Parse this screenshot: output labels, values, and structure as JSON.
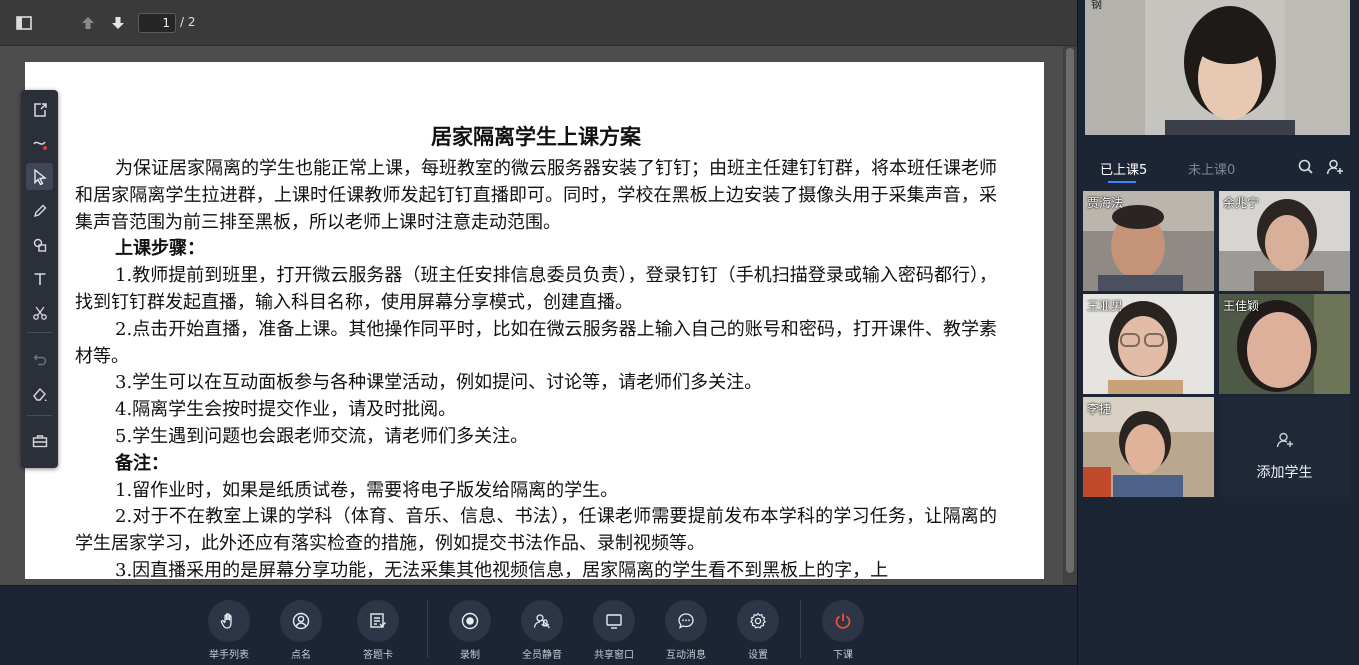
{
  "viewer": {
    "current_page": "1",
    "total_pages": "/ 2"
  },
  "document": {
    "title": "居家隔离学生上课方案",
    "paragraphs": [
      {
        "text": "为保证居家隔离的学生也能正常上课，每班教室的微云服务器安装了钉钉；由班主任建钉钉群，将本班任课老师和居家隔离学生拉进群，上课时任课教师发起钉钉直播即可。同时，学校在黑板上边安装了摄像头用于采集声音，采集声音范围为前三排至黑板，所以老师上课时注意走动范围。",
        "bold": false
      },
      {
        "text": "上课步骤：",
        "bold": true
      },
      {
        "text": "1.教师提前到班里，打开微云服务器（班主任安排信息委员负责），登录钉钉（手机扫描登录或输入密码都行），找到钉钉群发起直播，输入科目名称，使用屏幕分享模式，创建直播。",
        "bold": false
      },
      {
        "text": "2.点击开始直播，准备上课。其他操作同平时，比如在微云服务器上输入自己的账号和密码，打开课件、教学素材等。",
        "bold": false
      },
      {
        "text": "3.学生可以在互动面板参与各种课堂活动，例如提问、讨论等，请老师们多关注。",
        "bold": false
      },
      {
        "text": "4.隔离学生会按时提交作业，请及时批阅。",
        "bold": false
      },
      {
        "text": "5.学生遇到问题也会跟老师交流，请老师们多关注。",
        "bold": false
      },
      {
        "text": "备注：",
        "bold": true
      },
      {
        "text": "1.留作业时，如果是纸质试卷，需要将电子版发给隔离的学生。",
        "bold": false
      },
      {
        "text": "2.对于不在教室上课的学科（体育、音乐、信息、书法），任课老师需要提前发布本学科的学习任务，让隔离的学生居家学习，此外还应有落实检查的措施，例如提交书法作品、录制视频等。",
        "bold": false
      },
      {
        "text": "3.因直播采用的是屏幕分享功能，无法采集其他视频信息，居家隔离的学生看不到黑板上的字，上",
        "bold": false
      }
    ]
  },
  "right_panel": {
    "teacher_label": "钢",
    "tab_attending": "已上课5",
    "tab_absent": "未上课0",
    "students": [
      {
        "name": "贾海法"
      },
      {
        "name": "余兆宁"
      },
      {
        "name": "王亚男"
      },
      {
        "name": "王佳颖"
      },
      {
        "name": "李捷"
      }
    ],
    "add_student_label": "添加学生"
  },
  "controls": [
    {
      "label": "举手列表",
      "icon": "hand-icon"
    },
    {
      "label": "点名",
      "icon": "roll-call-icon"
    },
    {
      "label": "答题卡",
      "icon": "answer-card-icon"
    },
    {
      "label": "录制",
      "icon": "record-icon"
    },
    {
      "label": "全员静音",
      "icon": "mute-all-icon"
    },
    {
      "label": "共享窗口",
      "icon": "share-window-icon"
    },
    {
      "label": "互动消息",
      "icon": "chat-icon"
    },
    {
      "label": "设置",
      "icon": "gear-icon"
    },
    {
      "label": "下课",
      "icon": "power-icon"
    }
  ],
  "colors": {
    "end_class": "#f0503c",
    "tab_active": "#3d86ff"
  }
}
